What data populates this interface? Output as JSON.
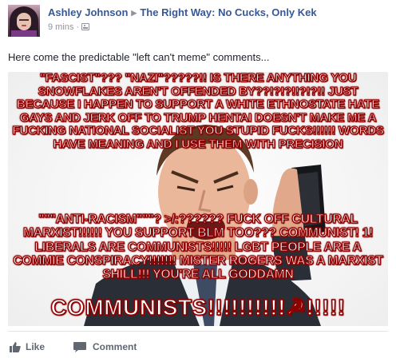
{
  "post": {
    "author": "Ashley Johnson",
    "group": "The Right Way: No Cucks, Only Kek",
    "time": "9 mins",
    "separator": "·",
    "text": "Here come the predictable \"left can't meme\" comments...",
    "meme": {
      "top_text": "\"FASCIST\"??? \"NAZI\"?????!! IS THERE ANYTHING YOU SNOWFLAKES AREN'T OFFENDED BY??!?!?!!?!?!! JUST BECAUSE I HAPPEN TO SUPPORT A WHITE ETHNOSTATE HATE GAYS AND JERK OFF TO TRUMP HENTAI DOESN'T MAKE ME A FUCKING NATIONAL SOCIALIST YOU STUPID FUCKS!!!!!! WORDS HAVE MEANING AND I USE THEM WITH PRECISION",
      "bottom_text": "\"\"\"ANTI-RACISM\"\"\"? >/:?????? FUCK OFF CULTURAL MARXIST!!!!!! YOU SUPPORT BLM TOO??? COMMUNIST! 1! LIBERALS ARE COMMUNISTS!!!!! LGBT PEOPLE ARE A COMMIE CONSPIRACY!!!!!!! MISTER ROGERS WAS A MARXIST SHILL!!! YOU'RE ALL GODDAMN",
      "big_text": "COMMUNISTS!!!!!!!!!!☭!!!!!"
    }
  },
  "actions": {
    "like_label": "Like",
    "comment_label": "Comment"
  },
  "colors": {
    "link": "#365899",
    "meta": "#90949c",
    "action": "#606770",
    "meme_text_outline": "#8c0000"
  },
  "icons": {
    "audience": "group-audience-icon",
    "like": "thumbs-up-icon",
    "comment": "speech-bubble-icon"
  }
}
